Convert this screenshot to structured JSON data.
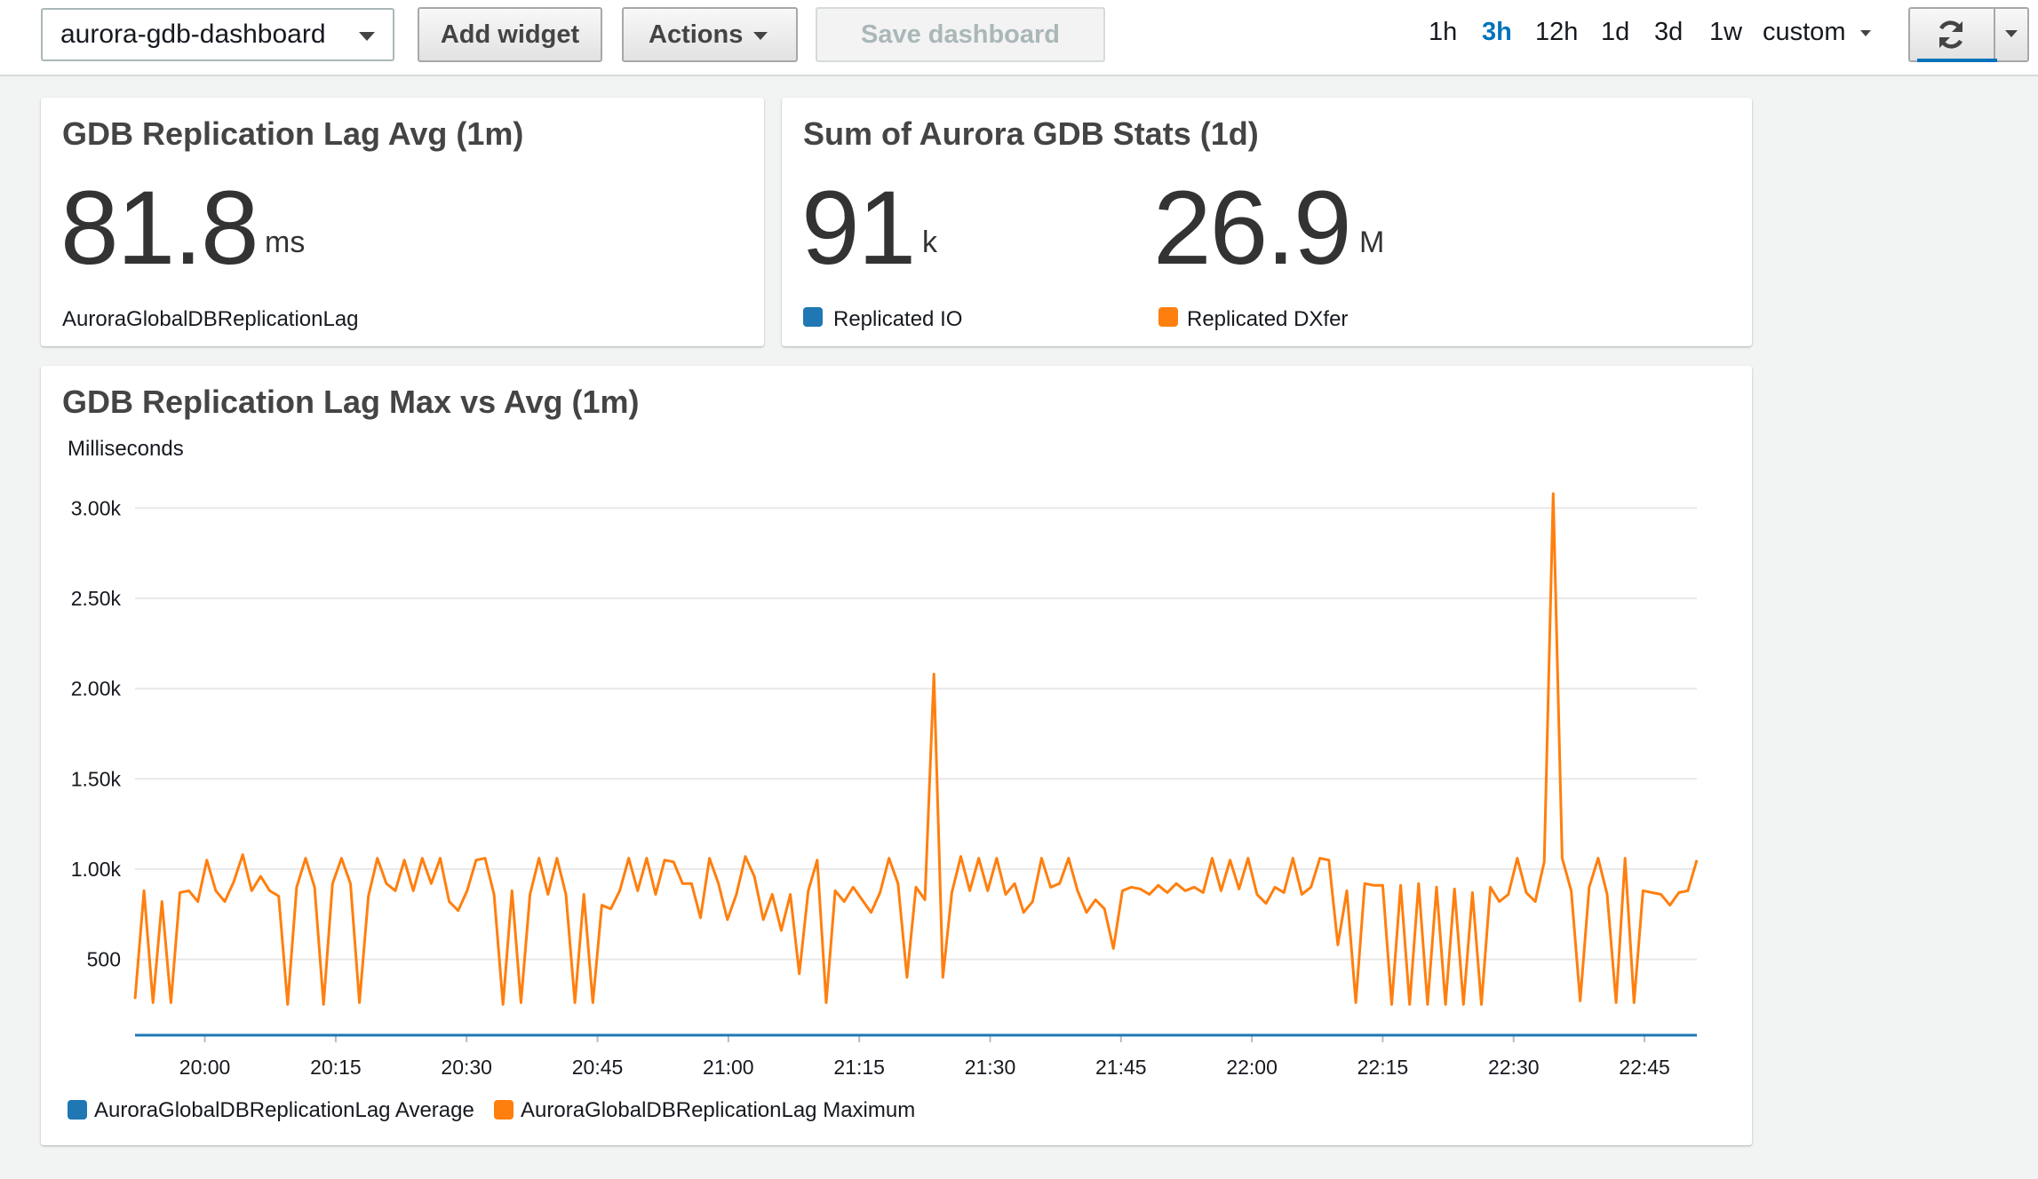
{
  "toolbar": {
    "dashboard_name": "aurora-gdb-dashboard",
    "add_widget": "Add widget",
    "actions": "Actions",
    "save_dashboard": "Save dashboard",
    "time_ranges": [
      "1h",
      "3h",
      "12h",
      "1d",
      "3d",
      "1w",
      "custom"
    ],
    "active_range": "3h"
  },
  "widget_lag_avg": {
    "title": "GDB Replication Lag Avg (1m)",
    "value": "81.8",
    "unit": "ms",
    "metric": "AuroraGlobalDBReplicationLag"
  },
  "widget_stats": {
    "title": "Sum of Aurora GDB Stats (1d)",
    "io_value": "91",
    "io_unit": "k",
    "io_label": "Replicated IO",
    "dx_value": "26.9",
    "dx_unit": "M",
    "dx_label": "Replicated DXfer"
  },
  "colors": {
    "blue": "#1f77b4",
    "orange": "#ff7f0e",
    "accent": "#0073bb"
  },
  "icons": {
    "refresh": "refresh-icon",
    "dropdown": "chevron-down-icon"
  },
  "chart_data": {
    "type": "line",
    "title": "GDB Replication Lag Max vs Avg (1m)",
    "ylabel": "Milliseconds",
    "ylim": [
      80,
      3080
    ],
    "y_ticks": [
      500,
      1000,
      1500,
      2000,
      2500,
      3000
    ],
    "y_tick_labels": [
      "500",
      "1.00k",
      "1.50k",
      "2.00k",
      "2.50k",
      "3.00k"
    ],
    "x_tick_labels": [
      "20:00",
      "20:15",
      "20:30",
      "20:45",
      "21:00",
      "21:15",
      "21:30",
      "21:45",
      "22:00",
      "22:15",
      "22:30",
      "22:45"
    ],
    "x_range_minutes": [
      -8,
      171
    ],
    "series": [
      {
        "name": "AuroraGlobalDBReplicationLag Average",
        "color": "#1f77b4",
        "values": [
          80,
          80,
          80,
          80,
          80,
          80,
          80,
          80,
          80,
          80,
          80,
          80,
          80,
          80,
          80,
          80,
          80,
          80,
          80,
          80,
          80,
          80,
          80,
          80,
          80,
          80,
          80,
          80,
          80,
          80,
          80,
          80,
          80,
          80,
          80,
          80,
          80,
          80,
          80,
          80,
          80,
          80,
          80,
          80,
          80,
          80,
          80,
          80,
          80,
          80,
          80,
          80,
          80,
          80,
          80,
          80,
          80,
          80,
          80,
          80,
          80,
          80,
          80,
          80,
          80,
          80,
          80,
          80,
          80,
          80,
          80,
          80,
          80,
          80,
          80,
          80,
          80,
          80,
          80,
          80,
          80,
          80,
          80,
          80,
          80,
          80,
          80,
          80,
          80,
          80,
          80,
          80,
          80,
          80,
          80,
          80,
          80,
          80,
          80,
          80,
          80,
          80,
          80,
          80,
          80,
          80,
          80,
          80,
          80,
          80,
          80,
          80,
          80,
          80,
          80,
          80,
          80,
          80,
          80,
          80,
          80,
          80,
          80,
          80,
          80,
          80,
          80,
          80,
          80,
          80,
          80,
          80,
          80,
          80,
          80,
          80,
          80,
          80,
          80,
          80,
          80,
          80,
          80,
          80,
          80,
          80,
          80,
          80,
          80,
          80,
          80,
          80,
          80,
          80,
          80,
          80,
          80,
          80,
          80,
          80,
          80,
          80,
          80,
          80,
          80,
          80,
          80,
          80,
          80,
          80,
          80,
          80,
          80,
          80,
          80,
          80,
          80,
          80,
          80
        ]
      },
      {
        "name": "AuroraGlobalDBReplicationLag Maximum",
        "color": "#ff7f0e",
        "values": [
          280,
          880,
          260,
          820,
          260,
          870,
          880,
          820,
          1050,
          880,
          820,
          930,
          1080,
          880,
          960,
          880,
          850,
          250,
          900,
          1060,
          900,
          250,
          920,
          1060,
          920,
          260,
          850,
          1060,
          920,
          880,
          1050,
          880,
          1060,
          920,
          1060,
          820,
          770,
          880,
          1050,
          1060,
          860,
          250,
          880,
          260,
          860,
          1060,
          860,
          1060,
          860,
          260,
          860,
          260,
          800,
          780,
          880,
          1060,
          880,
          1060,
          860,
          1050,
          1040,
          920,
          920,
          730,
          1060,
          920,
          720,
          860,
          1070,
          960,
          720,
          860,
          660,
          860,
          420,
          880,
          1050,
          260,
          880,
          820,
          900,
          830,
          760,
          870,
          1060,
          920,
          400,
          900,
          830,
          2080,
          400,
          870,
          1070,
          880,
          1060,
          880,
          1060,
          860,
          920,
          760,
          820,
          1060,
          900,
          920,
          1060,
          880,
          760,
          830,
          780,
          560,
          880,
          900,
          890,
          860,
          910,
          870,
          920,
          880,
          900,
          870,
          1060,
          880,
          1050,
          890,
          1060,
          860,
          810,
          900,
          870,
          1060,
          860,
          900,
          1060,
          1050,
          580,
          880,
          260,
          920,
          910,
          910,
          250,
          910,
          250,
          920,
          250,
          900,
          250,
          890,
          250,
          870,
          250,
          900,
          820,
          860,
          1060,
          870,
          820,
          1040,
          3080,
          1060,
          880,
          270,
          900,
          1060,
          860,
          260,
          1060,
          260,
          880,
          870,
          860,
          800,
          870,
          880,
          1050
        ]
      }
    ],
    "legend_position": "bottom-left",
    "grid": true
  }
}
